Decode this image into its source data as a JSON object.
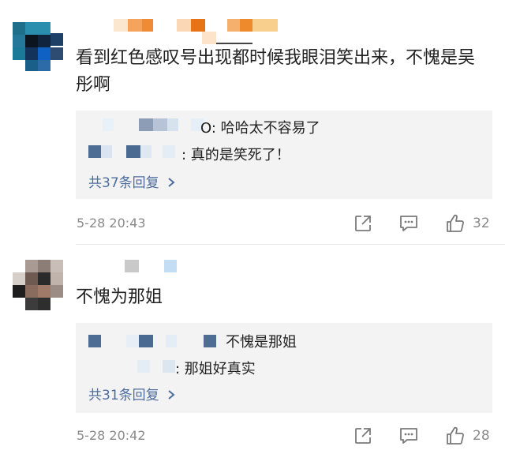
{
  "comments": [
    {
      "text": "看到红色感叹号出现都时候我眼泪笑出来，不愧是吴彤啊",
      "replies": [
        {
          "text": "O: 哈哈太不容易了"
        },
        {
          "text": ": 真的是笑死了！"
        }
      ],
      "reply_count": "共37条回复",
      "timestamp": "5-28 20:43",
      "likes": "32"
    },
    {
      "text": "不愧为那姐",
      "replies": [
        {
          "text": "不愧是那姐"
        },
        {
          "text": ": 那姐好真实"
        }
      ],
      "reply_count": "共31条回复",
      "timestamp": "5-28 20:42",
      "likes": "28"
    }
  ],
  "icons": {
    "share": "share-icon",
    "comment": "comment-icon",
    "like": "thumbs-up-icon",
    "chevron": "chevron-right-icon"
  },
  "colors": {
    "link": "#4e6d9e",
    "reply_bg": "#f3f3f3",
    "meta": "#8a8a8a"
  }
}
